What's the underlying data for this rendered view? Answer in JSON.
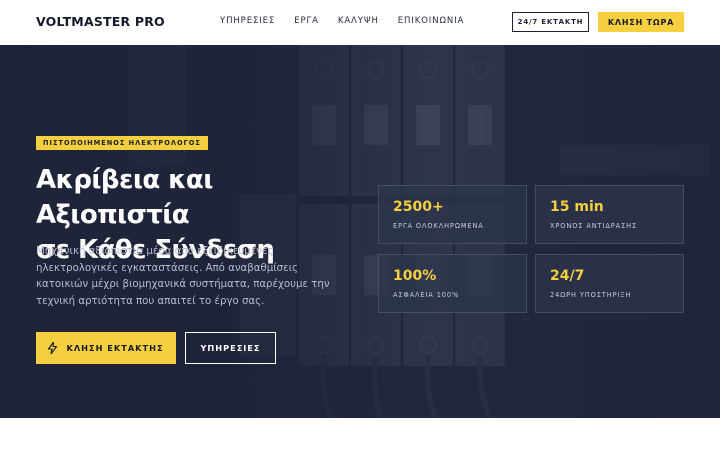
{
  "header": {
    "logo": "VOLTMASTER PRO",
    "nav": [
      "ΥΠΗΡΕΣΙΕΣ",
      "ΕΡΓΑ",
      "ΚΑΛΥΨΗ",
      "ΕΠΙΚΟΙΝΩΝΙΑ"
    ],
    "emergency_label": "24/7 ΕΚΤΑΚΤΗ",
    "call_label": "ΚΛΗΣΗ ΤΩΡΑ"
  },
  "hero": {
    "badge": "ΠΙΣΤΟΠΟΙΗΜΕΝΟΣ ΗΛΕΚΤΡΟΛΟΓΟΣ",
    "title_line1": "Ακρίβεια και Αξιοπιστία",
    "title_line2": "σε Κάθε Σύνδεση",
    "description": "Μηχανική αξιοπιστία μέσα από εξειδικευμένες ηλεκτρολογικές εγκαταστάσεις. Από αναβαθμίσεις κατοικιών μέχρι βιομηχανικά συστήματα, παρέχουμε την τεχνική αρτιότητα που απαιτεί το έργο σας.",
    "primary_button": "ΚΛΗΣΗ ΕΚΤΑΚΤΗΣ",
    "secondary_button": "ΥΠΗΡΕΣΙΕΣ",
    "stats": [
      {
        "value": "2500+",
        "label": "ΕΡΓΑ ΟΛΟΚΛΗΡΩΜΕΝΑ"
      },
      {
        "value": "15 min",
        "label": "ΧΡΟΝΟΣ ΑΝΤΙΔΡΑΣΗΣ"
      },
      {
        "value": "100%",
        "label": "ΑΣΦΑΛΕΙΑ 100%"
      },
      {
        "value": "24/7",
        "label": "24ΩΡΗ ΥΠΟΣΤΗΡΙΞΗ"
      }
    ]
  },
  "colors": {
    "accent": "#f5cf3e",
    "hero_dark": "#1d2338",
    "text_dark": "#131a2b"
  },
  "icons": {
    "primary_button_icon": "lightning-bolt-icon"
  }
}
